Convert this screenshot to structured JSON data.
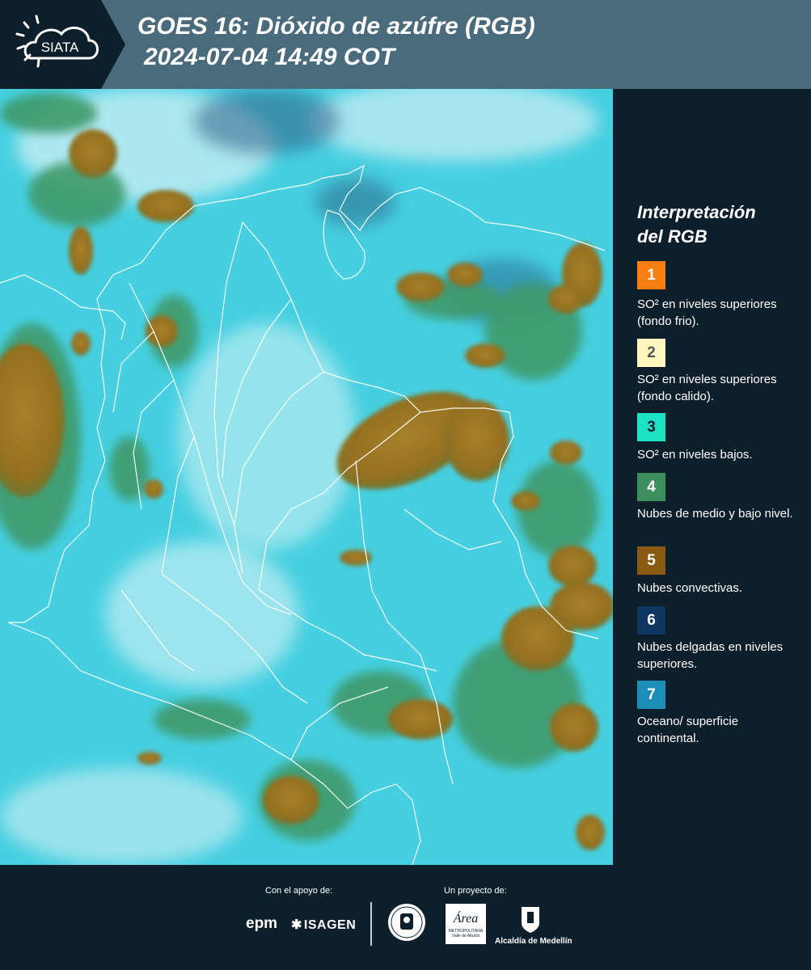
{
  "header": {
    "logo_text": "SIATA",
    "title_line1": "GOES 16: Dióxido de azúfre (RGB)",
    "title_line2": "2024-07-04 14:49 COT"
  },
  "legend": {
    "title_line1": "Interpretación",
    "title_line2": "del RGB",
    "items": [
      {
        "number": "1",
        "color": "#f77e10",
        "label": "SO² en niveles superiores (fondo frio)."
      },
      {
        "number": "2",
        "color": "#fff7c0",
        "label": "SO² en niveles superiores (fondo calido)."
      },
      {
        "number": "3",
        "color": "#1de2c4",
        "label": "SO² en niveles bajos."
      },
      {
        "number": "4",
        "color": "#3d8f5e",
        "label": "Nubes de medio y bajo nivel."
      },
      {
        "number": "5",
        "color": "#8a5a12",
        "label": "Nubes convectivas."
      },
      {
        "number": "6",
        "color": "#0f3561",
        "label": "Nubes delgadas en niveles superiores."
      },
      {
        "number": "7",
        "color": "#1b8fb8",
        "label": "Oceano/ superficie continental."
      }
    ]
  },
  "footer": {
    "support_label": "Con el apoyo de:",
    "project_label": "Un proyecto de:",
    "epm_logo": "epm",
    "isagen_logo": "ISAGEN",
    "area_logo_word": "Área",
    "area_logo_sub": "METROPOLITANA Valle de Aburrá",
    "alcaldia_label": "Alcaldía de Medellín"
  },
  "colors": {
    "header_bg": "#4a6b7c",
    "page_bg": "#0e1f2c",
    "map_cyan": "#3fd0e2",
    "map_green": "#3f9a6a",
    "map_convective": "#9e7a26"
  }
}
